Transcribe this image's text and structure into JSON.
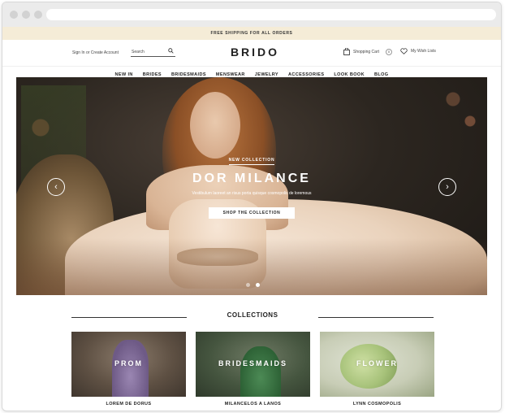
{
  "promo": {
    "text": "FREE SHIPPING FOR ALL ORDERS"
  },
  "header": {
    "signin": "Sign In or Create Account",
    "search_placeholder": "Search",
    "logo": "BRIDO",
    "cart_label": "Shopping Cart",
    "cart_count": "0",
    "wishlist_label": "My Wish Lists"
  },
  "nav": {
    "items": [
      {
        "label": "NEW IN"
      },
      {
        "label": "BRIDES"
      },
      {
        "label": "BRIDESMAIDS"
      },
      {
        "label": "MENSWEAR"
      },
      {
        "label": "JEWELRY"
      },
      {
        "label": "ACCESSORIES"
      },
      {
        "label": "LOOK BOOK"
      },
      {
        "label": "BLOG"
      }
    ]
  },
  "hero": {
    "eyebrow": "NEW COLLECTION",
    "title": "DOR MILANCE",
    "subtitle": "Vestibulum laoreet an risus porta quisque cosmopolis de loremous",
    "cta": "SHOP THE COLLECTION",
    "prev_glyph": "‹",
    "next_glyph": "›",
    "slide_count": 2,
    "active_slide": 2
  },
  "collections": {
    "title": "COLLECTIONS",
    "cards": [
      {
        "label": "PROM",
        "caption": "LOREM DE DORUS"
      },
      {
        "label": "BRIDESMAIDS",
        "caption": "MILANCELOS A LANOS"
      },
      {
        "label": "FLOWER",
        "caption": "LYNN COSMOPOLIS"
      }
    ]
  },
  "icons": {
    "search": "search-icon",
    "cart": "bag-icon",
    "wishlist": "heart-icon"
  }
}
